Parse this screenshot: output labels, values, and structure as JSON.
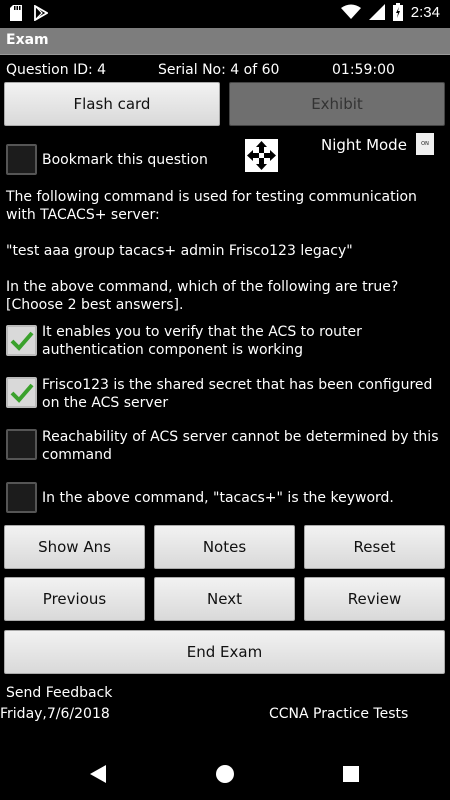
{
  "status": {
    "time": "2:34"
  },
  "app": {
    "title": "Exam"
  },
  "info": {
    "question_id": "Question ID: 4",
    "serial": "Serial No: 4 of 60",
    "timer": "01:59:00"
  },
  "top_buttons": {
    "flash_card": "Flash card",
    "exhibit": "Exhibit"
  },
  "bookmark": {
    "label": "Bookmark this question"
  },
  "night_mode": {
    "label": "Night Mode",
    "toggle": "ON"
  },
  "question": {
    "intro": "The following command is used for testing communication with TACACS+ server:",
    "command": "\"test aaa group tacacs+ admin Frisco123 legacy\"",
    "prompt": "In the above command, which of the following are true? [Choose 2 best answers]."
  },
  "options": [
    {
      "text": "It enables you to verify that the ACS to router authentication component is working",
      "checked": true
    },
    {
      "text": "Frisco123 is the shared secret that has been configured on the ACS server",
      "checked": true
    },
    {
      "text": "Reachability of ACS server cannot be determined by this command",
      "checked": false
    },
    {
      "text": "In the above command, \"tacacs+\" is the keyword.",
      "checked": false
    }
  ],
  "buttons": {
    "show_ans": "Show Ans",
    "notes": "Notes",
    "reset": "Reset",
    "previous": "Previous",
    "next": "Next",
    "review": "Review",
    "end_exam": "End Exam"
  },
  "footer": {
    "feedback": "Send Feedback",
    "date": "Friday,7/6/2018",
    "app_name": "CCNA Practice Tests"
  },
  "colors": {
    "check": "#3aa12c",
    "titlebar": "#7d7d7d"
  }
}
